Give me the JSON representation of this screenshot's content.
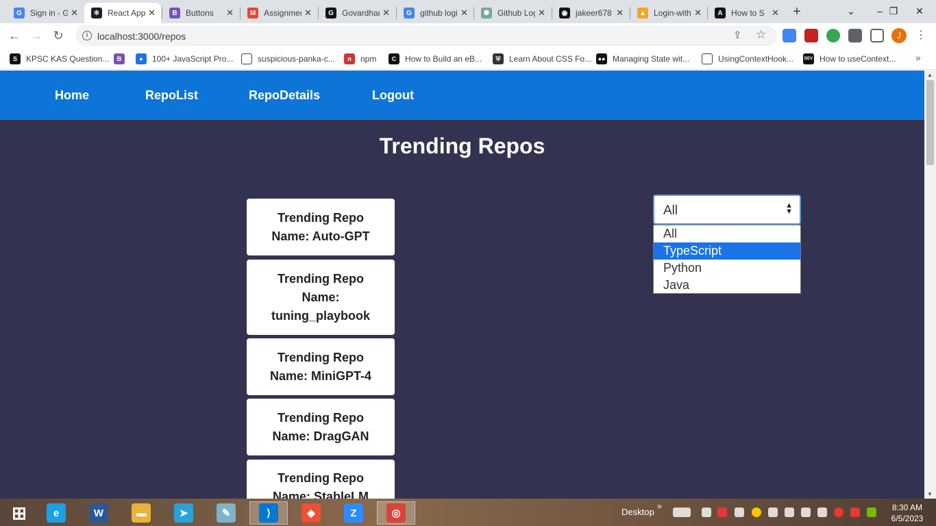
{
  "browser": {
    "tabs": [
      {
        "title": "Sign in - Google",
        "icon": "google-icon",
        "color": "#4285f4",
        "letter": "G"
      },
      {
        "title": "React App",
        "icon": "react-icon",
        "color": "#1b1f2a",
        "letter": "⚛"
      },
      {
        "title": "Buttons",
        "icon": "bootstrap-icon",
        "color": "#7952b3",
        "letter": "B"
      },
      {
        "title": "Assignment",
        "icon": "gmail-icon",
        "color": "#ea4335",
        "letter": "M"
      },
      {
        "title": "Govardhan",
        "icon": "letter-g-icon",
        "color": "#111111",
        "letter": "G"
      },
      {
        "title": "github login",
        "icon": "google-icon",
        "color": "#4285f4",
        "letter": "G"
      },
      {
        "title": "Github Login",
        "icon": "openai-icon",
        "color": "#74aa9c",
        "letter": "✺"
      },
      {
        "title": "jakeer678",
        "icon": "github-icon",
        "color": "#111111",
        "letter": "◉"
      },
      {
        "title": "Login-with",
        "icon": "firebase-icon",
        "color": "#f5a623",
        "letter": "▲"
      },
      {
        "title": "How to S",
        "icon": "auth0-icon",
        "color": "#111111",
        "letter": "A"
      }
    ],
    "url": "localhost:3000/repos",
    "window_controls": {
      "minimize": "–",
      "restore": "❐",
      "close": "✕"
    },
    "bookmarks": [
      {
        "label": "KPSC KAS Question...",
        "icon": "kpsc-icon",
        "color": "#111111",
        "letter": "S"
      },
      {
        "label": "",
        "icon": "bootstrap-icon",
        "color": "#7952b3",
        "letter": "B"
      },
      {
        "label": "100+ JavaScript Pro...",
        "icon": "globe-icon",
        "color": "#1a73e8",
        "letter": "●"
      },
      {
        "label": "suspicious-panka-c...",
        "icon": "page-icon",
        "color": "#ffffff",
        "letter": ""
      },
      {
        "label": "npm",
        "icon": "npm-icon",
        "color": "#cb3837",
        "letter": "n"
      },
      {
        "label": "How to Build an eB...",
        "icon": "codecademy-icon",
        "color": "#111111",
        "letter": "C"
      },
      {
        "label": "Learn About CSS Fo...",
        "icon": "shield-icon",
        "color": "#333333",
        "letter": "⛨"
      },
      {
        "label": "Managing State wit...",
        "icon": "medium-icon",
        "color": "#111111",
        "letter": "●●"
      },
      {
        "label": "UsingContextHook...",
        "icon": "page-icon",
        "color": "#ffffff",
        "letter": ""
      },
      {
        "label": "How to useContext...",
        "icon": "dev-icon",
        "color": "#111111",
        "letter": "DEV"
      }
    ]
  },
  "app": {
    "nav": [
      "Home",
      "RepoList",
      "RepoDetails",
      "Logout"
    ],
    "title": "Trending Repos",
    "repos": [
      "Trending Repo Name: Auto-GPT",
      "Trending Repo Name: tuning_playbook",
      "Trending Repo Name: MiniGPT-4",
      "Trending Repo Name: DragGAN",
      "Trending Repo Name: StableLM"
    ],
    "filter": {
      "selected": "All",
      "options": [
        "All",
        "TypeScript",
        "Python",
        "Java"
      ],
      "highlighted": "TypeScript"
    }
  },
  "taskbar": {
    "apps": [
      {
        "name": "windows-start-icon",
        "color": "#ffffff",
        "letter": "⊞"
      },
      {
        "name": "internet-explorer-icon",
        "color": "#1ba1e2",
        "letter": "e"
      },
      {
        "name": "word-icon",
        "color": "#2b579a",
        "letter": "W"
      },
      {
        "name": "file-explorer-icon",
        "color": "#e8b339",
        "letter": "▬"
      },
      {
        "name": "telegram-icon",
        "color": "#2aa1da",
        "letter": "➤"
      },
      {
        "name": "notepad-icon",
        "color": "#7fb3c9",
        "letter": "✎"
      },
      {
        "name": "vscode-icon",
        "color": "#0078d4",
        "letter": "⟩"
      },
      {
        "name": "git-icon",
        "color": "#f05033",
        "letter": "◆"
      },
      {
        "name": "zoom-icon",
        "color": "#2d8cff",
        "letter": "Z"
      },
      {
        "name": "chrome-icon",
        "color": "#db4437",
        "letter": "◎"
      }
    ],
    "desktop_label": "Desktop",
    "time": "8:30 AM",
    "date": "6/5/2023"
  }
}
